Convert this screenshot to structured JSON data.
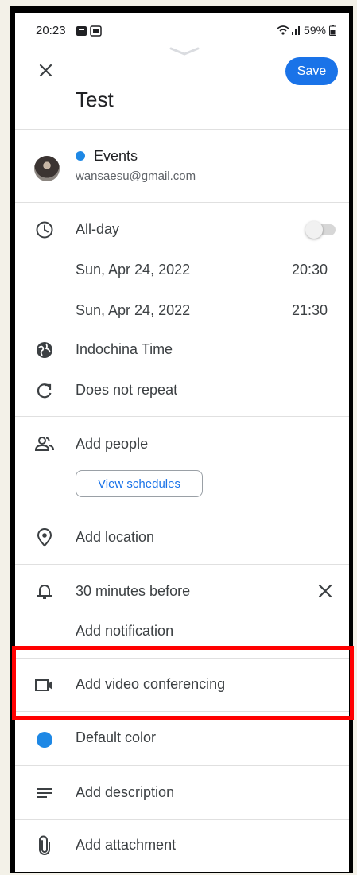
{
  "status_bar": {
    "time": "20:23",
    "battery": "59%"
  },
  "header": {
    "save_label": "Save",
    "title": "Test"
  },
  "calendar": {
    "name": "Events",
    "email": "wansaesu@gmail.com",
    "dot_color": "#1e88e5"
  },
  "schedule": {
    "all_day_label": "All-day",
    "all_day_enabled": false,
    "start_date": "Sun, Apr 24, 2022",
    "start_time": "20:30",
    "end_date": "Sun, Apr 24, 2022",
    "end_time": "21:30",
    "timezone": "Indochina Time",
    "repeat": "Does not repeat"
  },
  "people": {
    "add_label": "Add people",
    "view_schedules_label": "View schedules"
  },
  "location": {
    "add_label": "Add location"
  },
  "notification": {
    "current": "30 minutes before",
    "add_label": "Add notification"
  },
  "video": {
    "add_label": "Add video conferencing"
  },
  "color": {
    "label": "Default color",
    "value": "#1e88e5"
  },
  "description": {
    "add_label": "Add description"
  },
  "attachment": {
    "add_label": "Add attachment"
  },
  "colors": {
    "accent": "#1a73e8",
    "highlight": "#ff0000"
  }
}
